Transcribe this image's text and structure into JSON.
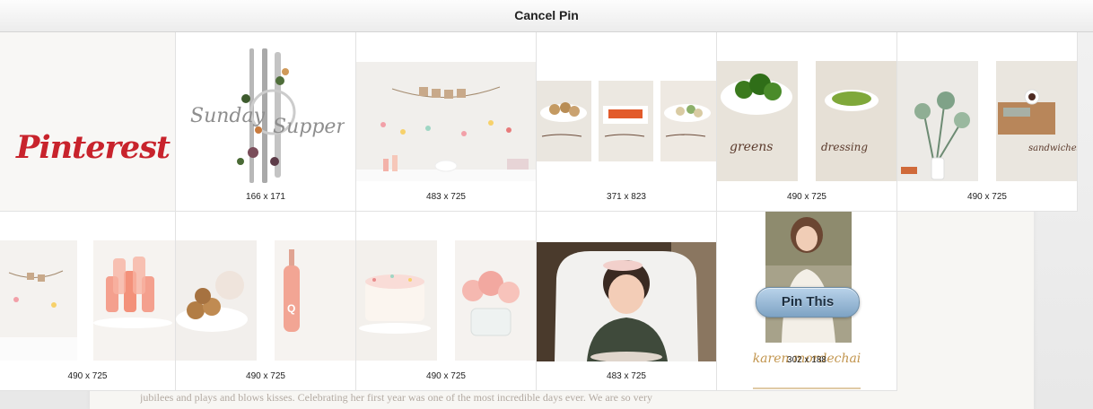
{
  "header": {
    "cancel_label": "Cancel Pin"
  },
  "logo": {
    "text": "Pinterest"
  },
  "background": {
    "text": "jubilees and plays and blows kisses. Celebrating her first year was one of the most incredible days ever. We are so very"
  },
  "images": [
    {
      "dimensions": "166 x 171"
    },
    {
      "dimensions": "483 x 725"
    },
    {
      "dimensions": "371 x 823"
    },
    {
      "dimensions": "490 x 725"
    },
    {
      "dimensions": "490 x 725"
    },
    {
      "dimensions": "490 x 725"
    },
    {
      "dimensions": "490 x 725"
    },
    {
      "dimensions": "490 x 725"
    },
    {
      "dimensions": "483 x 725"
    },
    {
      "dimensions": "302 x 188"
    }
  ],
  "pin_button": {
    "label": "Pin This"
  },
  "colors": {
    "pinterest_red": "#c8232c",
    "button_blue": "#8fb2d2"
  }
}
